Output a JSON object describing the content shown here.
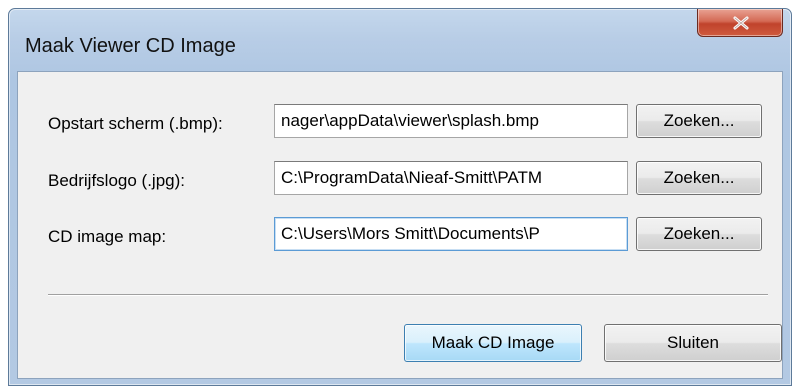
{
  "window": {
    "title": "Maak Viewer CD Image"
  },
  "fields": [
    {
      "label": "Opstart scherm (.bmp):",
      "value": "nager\\appData\\viewer\\splash.bmp",
      "browse_label": "Zoeken..."
    },
    {
      "label": "Bedrijfslogo (.jpg):",
      "value": "C:\\ProgramData\\Nieaf-Smitt\\PATM",
      "browse_label": "Zoeken..."
    },
    {
      "label": "CD image map:",
      "value": "C:\\Users\\Mors Smitt\\Documents\\P",
      "browse_label": "Zoeken..."
    }
  ],
  "buttons": {
    "create_label": "Maak CD Image",
    "close_label": "Sluiten"
  },
  "icons": {
    "close": "close-icon"
  },
  "colors": {
    "title_bar": "#b8cde6",
    "close_button": "#c7462f",
    "default_button_border": "#3c7fb1",
    "dialog_background": "#f0f0f0"
  }
}
